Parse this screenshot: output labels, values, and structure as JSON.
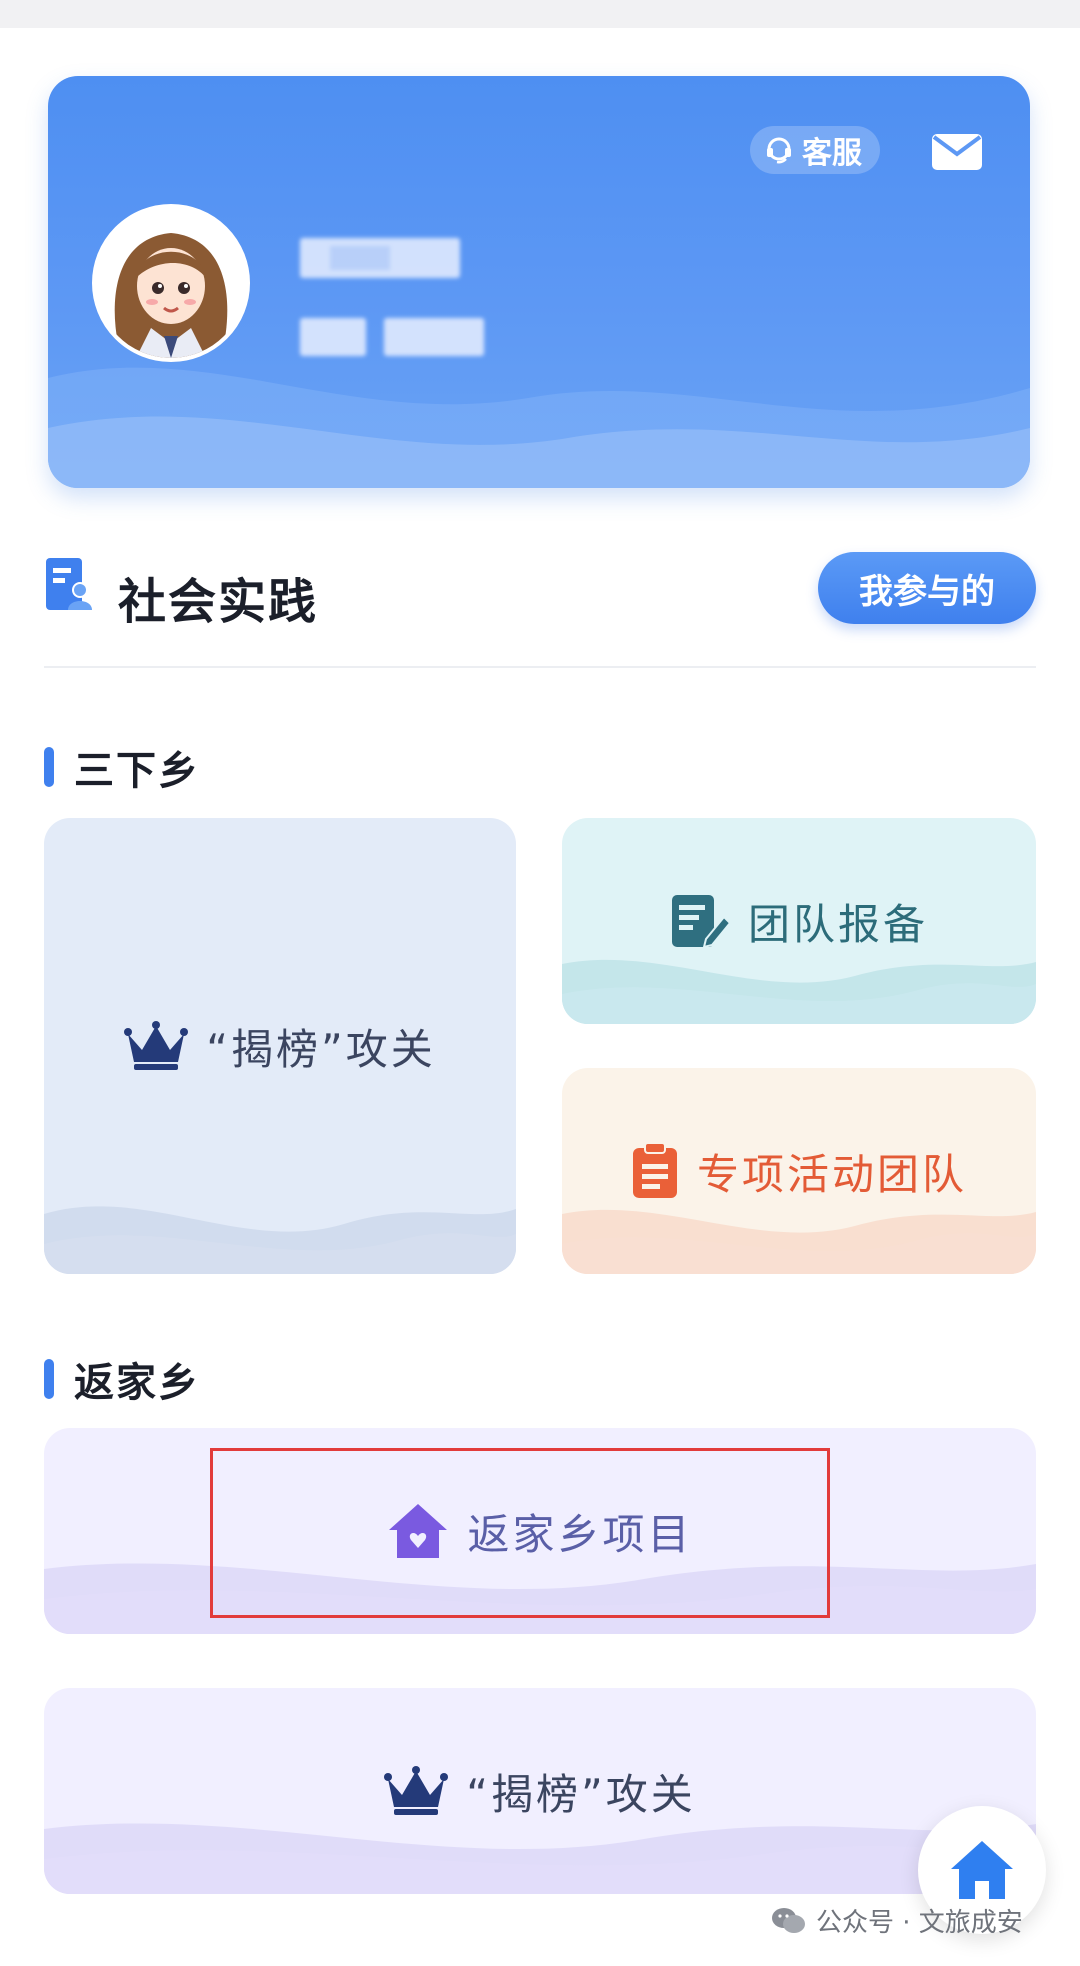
{
  "header": {
    "kefu_label": "客服"
  },
  "section": {
    "title": "社会实践",
    "mine_button": "我参与的"
  },
  "sanxiaxiang": {
    "title": "三下乡",
    "tiles": [
      {
        "label": "“揭榜”攻关",
        "icon": "crown-icon"
      },
      {
        "label": "团队报备",
        "icon": "edit-document-icon"
      },
      {
        "label": "专项活动团队",
        "icon": "clipboard-icon"
      }
    ]
  },
  "fanjiaxiang": {
    "title": "返家乡",
    "tiles": [
      {
        "label": "返家乡项目",
        "icon": "house-heart-icon"
      },
      {
        "label": "“揭榜”攻关",
        "icon": "crown-icon"
      }
    ]
  },
  "watermark": {
    "text": "公众号 · 文旅成安"
  },
  "colors": {
    "primary": "#4e8ff2",
    "highlight": "#e23b3b"
  }
}
